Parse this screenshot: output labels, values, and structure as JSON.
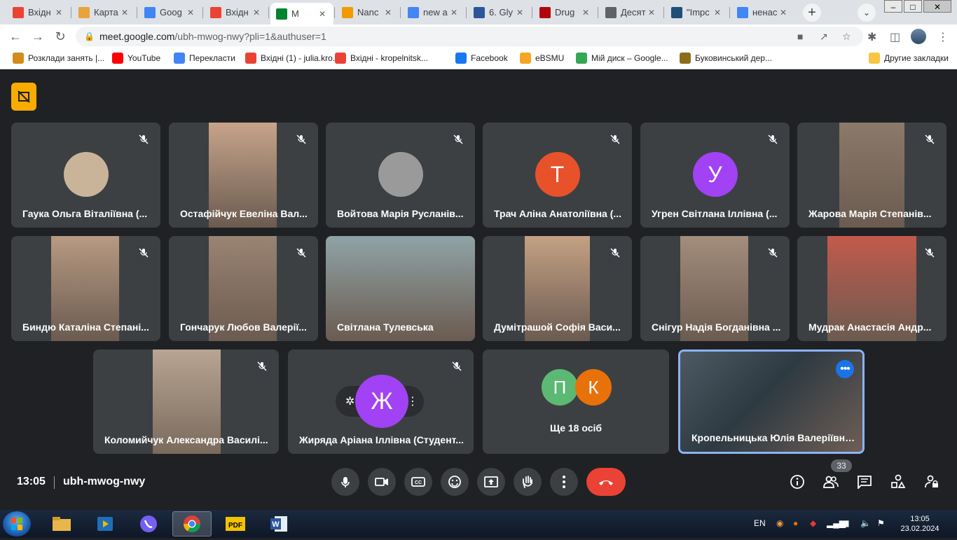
{
  "browser": {
    "tabs": [
      {
        "label": "Вхідн",
        "icon": "gmail-icon",
        "color": "#ea4335"
      },
      {
        "label": "Карта",
        "icon": "hat-icon",
        "color": "#e8a33b"
      },
      {
        "label": "Goog",
        "icon": "translate-icon",
        "color": "#4285f4"
      },
      {
        "label": "Вхідн",
        "icon": "gmail-icon",
        "color": "#ea4335"
      },
      {
        "label": "M",
        "icon": "meet-icon",
        "color": "#00832d"
      },
      {
        "label": "Nanc",
        "icon": "diamond-icon",
        "color": "#f29900"
      },
      {
        "label": "new a",
        "icon": "google-icon",
        "color": "#4285f4"
      },
      {
        "label": "6. Gly",
        "icon": "bookmark-icon",
        "color": "#2b579a"
      },
      {
        "label": "Drug",
        "icon": "stanford-icon",
        "color": "#b1040e"
      },
      {
        "label": "Десят",
        "icon": "globe-icon",
        "color": "#5f6368"
      },
      {
        "label": "\"Impc",
        "icon": "n-icon",
        "color": "#1f4e79"
      },
      {
        "label": "ненас",
        "icon": "google-icon",
        "color": "#4285f4"
      }
    ],
    "url_host": "meet.google.com",
    "url_path": "/ubh-mwog-nwy?pli=1&authuser=1",
    "bookmarks": [
      {
        "label": "Розклади занять |...",
        "icon": "hat-icon",
        "color": "#d48b1d"
      },
      {
        "label": "YouTube",
        "icon": "youtube-icon",
        "color": "#ff0000"
      },
      {
        "label": "Перекласти",
        "icon": "translate-icon",
        "color": "#4285f4"
      },
      {
        "label": "Вхідні (1) - julia.kro...",
        "icon": "gmail-icon",
        "color": "#ea4335"
      },
      {
        "label": "Вхідні - kropelnitsk...",
        "icon": "gmail-icon",
        "color": "#ea4335"
      },
      {
        "label": "Facebook",
        "icon": "facebook-icon",
        "color": "#1877f2"
      },
      {
        "label": "eBSMU",
        "icon": "ebsmu-icon",
        "color": "#f5a623"
      },
      {
        "label": "Мій диск – Google...",
        "icon": "drive-icon",
        "color": "#34a853"
      },
      {
        "label": "Буковинський дер...",
        "icon": "university-icon",
        "color": "#8a6d1d"
      }
    ],
    "other_bookmarks": "Другие закладки"
  },
  "meet": {
    "participants": [
      {
        "name": "Гаука Ольга Віталіївна (...",
        "type": "avatar-photo",
        "color": "#c9b49a"
      },
      {
        "name": "Остафійчук Евеліна Вал...",
        "type": "video",
        "color": "#c7a48a"
      },
      {
        "name": "Войтова Марія Русланів...",
        "type": "avatar-photo",
        "color": "#9a9a9a"
      },
      {
        "name": "Трач Аліна Анатоліївна (...",
        "type": "letter",
        "letter": "Т",
        "color": "#e8522a"
      },
      {
        "name": "Угрен Світлана Іллівна (...",
        "type": "letter",
        "letter": "У",
        "color": "#a142f4"
      },
      {
        "name": "Жарова Марія Степанів...",
        "type": "video",
        "color": "#8b7a6a"
      },
      {
        "name": "Биндю Каталіна Степані...",
        "type": "video",
        "color": "#b79a82"
      },
      {
        "name": "Гончарук Любов Валерії...",
        "type": "video",
        "color": "#9a8372"
      },
      {
        "name": "Світлана Тулевська",
        "type": "video",
        "color": "#8fa3a6"
      },
      {
        "name": "Думітрашой Софія Васи...",
        "type": "video",
        "color": "#c4a184"
      },
      {
        "name": "Снігур Надія Богданівна ...",
        "type": "video",
        "color": "#a38d7c"
      },
      {
        "name": "Мудрак Анастасія Андр...",
        "type": "video",
        "color": "#c25a4c"
      },
      {
        "name": "Коломийчук Александра Василі...",
        "type": "video",
        "color": "#b8a592"
      },
      {
        "name": "Жиряда Аріана Іллівна (Студент...",
        "type": "letter",
        "letter": "Ж",
        "color": "#a142f4"
      }
    ],
    "others": {
      "label": "Ще 18 осіб",
      "letters": [
        "П",
        "К"
      ],
      "colors": [
        "#5bb974",
        "#e8710a"
      ]
    },
    "self": {
      "name": "Кропельницька Юлія Валеріївна...",
      "color": "#4e5a63"
    },
    "time": "13:05",
    "meeting_code": "ubh-mwog-nwy",
    "participant_count": "33"
  },
  "taskbar": {
    "lang": "EN",
    "time": "13:05",
    "date": "23.02.2024"
  }
}
